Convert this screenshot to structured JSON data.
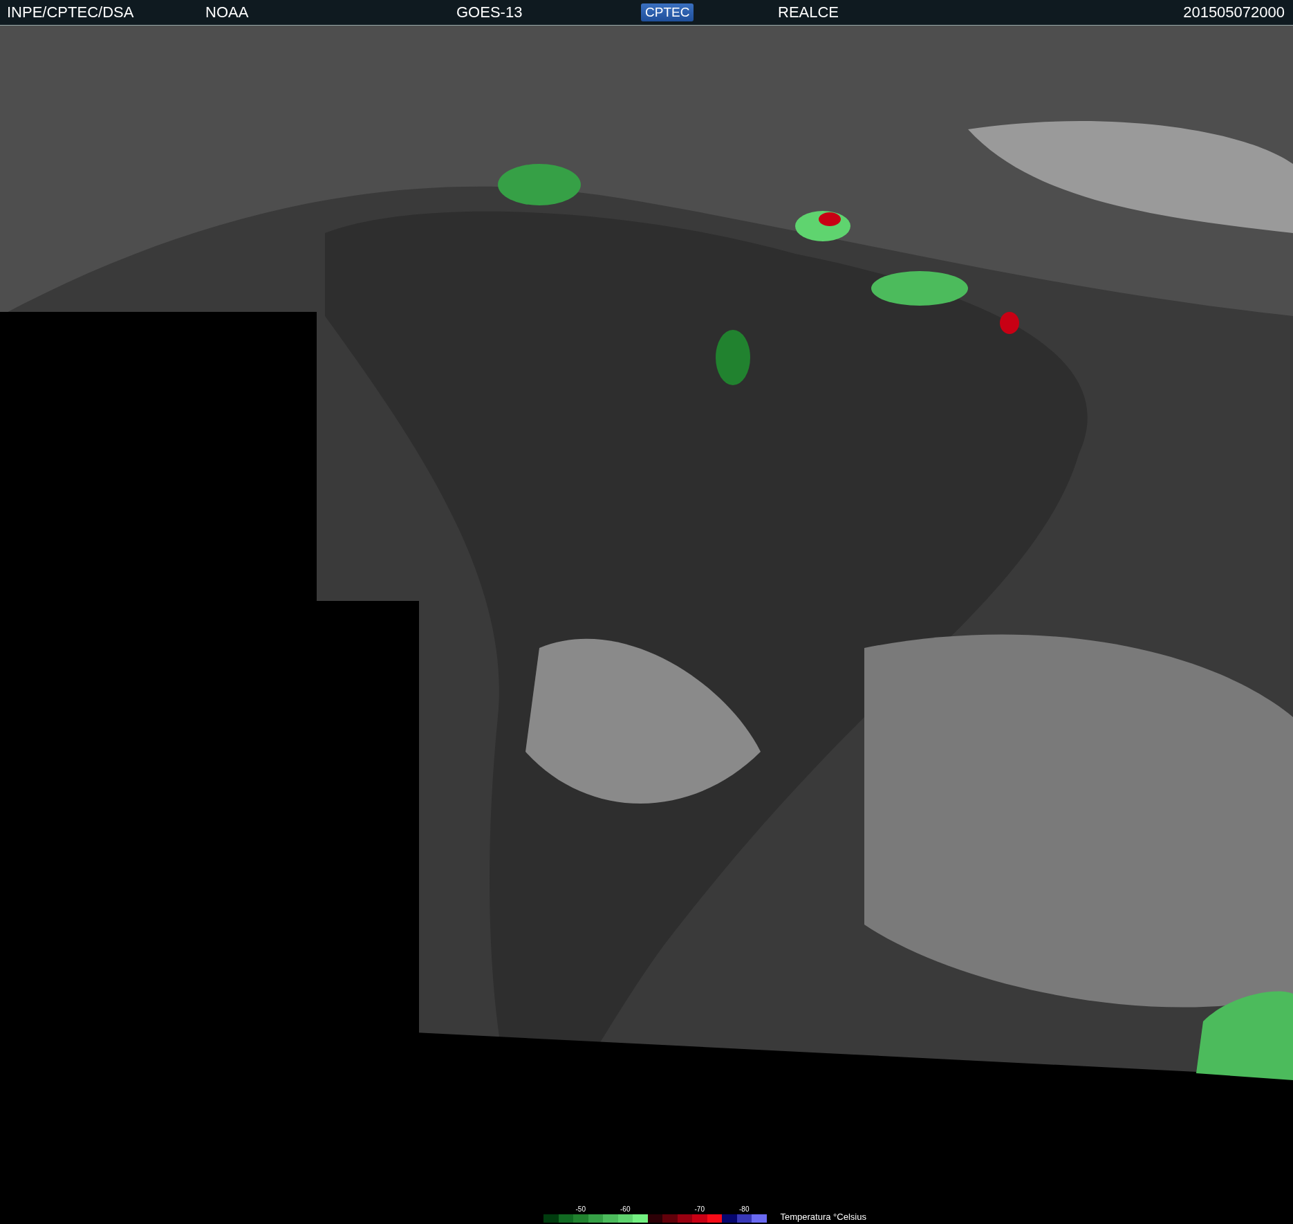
{
  "header": {
    "items": [
      {
        "kind": "text",
        "text": "INPE/CPTEC/DSA"
      },
      {
        "kind": "text",
        "text": "NOAA"
      },
      {
        "kind": "text",
        "text": "GOES-13"
      },
      {
        "kind": "logo",
        "text": "CPTEC"
      },
      {
        "kind": "text",
        "text": "REALCE"
      },
      {
        "kind": "text",
        "text": "201505072000"
      }
    ]
  },
  "legend": {
    "title": "Temperatura °Celsius",
    "swatches": [
      {
        "color": "#003c0e"
      },
      {
        "color": "#116a22"
      },
      {
        "color": "#21822f",
        "label": "-50"
      },
      {
        "color": "#36a046"
      },
      {
        "color": "#4cbb5c"
      },
      {
        "color": "#5fd46f",
        "label": "-60"
      },
      {
        "color": "#74f082"
      },
      {
        "color": "#2c0006"
      },
      {
        "color": "#62000a"
      },
      {
        "color": "#980010"
      },
      {
        "color": "#c80014",
        "label": "-70"
      },
      {
        "color": "#f80c18"
      },
      {
        "color": "#06066e"
      },
      {
        "color": "#3838b8",
        "label": "-80"
      },
      {
        "color": "#6a6af2"
      }
    ]
  }
}
